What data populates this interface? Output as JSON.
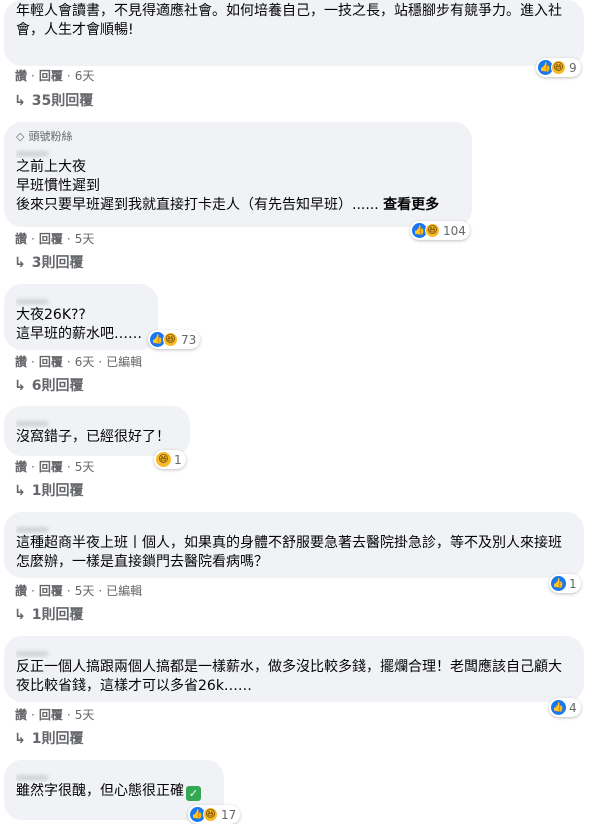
{
  "comments": [
    {
      "text": "年輕人會讀書，不見得適應社會。如何培養自己，一技之長，站穩腳步有競爭力。進入社會，人生才會順暢!",
      "reactions": "9",
      "meta": {
        "like": "讚",
        "reply": "回覆",
        "time": "6天"
      },
      "replies": "35則回覆"
    },
    {
      "badge": "頭號粉絲",
      "author": "‥‥‥‥",
      "text": "之前上大夜\n早班慣性遲到\n後來只要早班遲到我就直接打卡走人（有先告知早班）......",
      "see_more": "查看更多",
      "reactions": "104",
      "meta": {
        "like": "讚",
        "reply": "回覆",
        "time": "5天"
      },
      "replies": "3則回覆"
    },
    {
      "author": "‥‥‥‥",
      "text": "大夜26K??\n這早班的薪水吧……",
      "reactions": "73",
      "meta": {
        "like": "讚",
        "reply": "回覆",
        "time": "6天",
        "edited": "已編輯"
      },
      "replies": "6則回覆"
    },
    {
      "author": "‥‥‥‥",
      "text": "沒窩錯子，已經很好了！",
      "reactions": "1",
      "meta": {
        "like": "讚",
        "reply": "回覆",
        "time": "5天"
      },
      "replies": "1則回覆"
    },
    {
      "author": "‥‥‥‥",
      "text": "這種超商半夜上班丨個人，如果真的身體不舒服要急著去醫院掛急診，等不及別人來接班怎麼辦，一樣是直接鎖門去醫院看病嗎？",
      "reactions": "1",
      "meta": {
        "like": "讚",
        "reply": "回覆",
        "time": "5天",
        "edited": "已編輯"
      },
      "replies": "1則回覆"
    },
    {
      "author": "‥‥‥‥",
      "text": "反正一個人搞跟兩個人搞都是一樣薪水，做多沒比較多錢，擺爛合理！老闆應該自己顧大夜比較省錢，這樣才可以多省26k……",
      "reactions": "4",
      "meta": {
        "like": "讚",
        "reply": "回覆",
        "time": "5天"
      },
      "replies": "1則回覆"
    },
    {
      "author": "‥‥‥‥",
      "text": "雖然字很醜，但心態很正確",
      "reactions": "17"
    }
  ],
  "colors": {
    "bubble": "#f0f2f5",
    "meta": "#65676b",
    "like": "#1877f2",
    "haha": "#f7b928",
    "check": "#34a853"
  },
  "icons": {
    "like": "thumbs-up-icon",
    "haha": "laughing-face-icon",
    "reply": "reply-arrow-icon",
    "badge": "diamond-icon",
    "check": "check-mark-icon"
  }
}
